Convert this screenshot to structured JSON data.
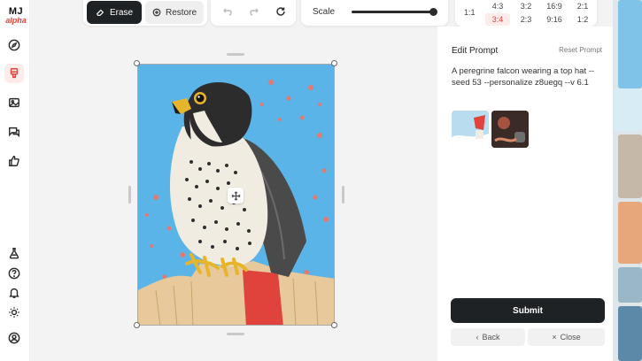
{
  "app": {
    "logo_main": "MJ",
    "logo_sub": "alpha"
  },
  "sidebar": {
    "items": [
      {
        "name": "explore",
        "icon": "compass-icon"
      },
      {
        "name": "create",
        "icon": "brush-icon",
        "active": true
      },
      {
        "name": "organize",
        "icon": "image-icon"
      },
      {
        "name": "chat",
        "icon": "chat-icon"
      },
      {
        "name": "rate",
        "icon": "thumbs-up-icon"
      }
    ],
    "bottom": [
      "flask-icon",
      "help-icon",
      "bell-icon",
      "sun-icon",
      "profile-icon"
    ]
  },
  "toolbar": {
    "erase_label": "Erase",
    "restore_label": "Restore",
    "scale_label": "Scale",
    "scale_value": 1.0
  },
  "aspect": {
    "main": "1:1",
    "options": [
      "4:3",
      "3:2",
      "16:9",
      "2:1",
      "3:4",
      "2:3",
      "9:16",
      "1:2"
    ],
    "selected": "3:4"
  },
  "panel": {
    "title": "Edit Prompt",
    "reset_label": "Reset Prompt",
    "prompt_text": "A peregrine falcon wearing a top hat --seed 53 --personalize z8uegq --v 6.1",
    "submit_label": "Submit",
    "back_label": "Back",
    "close_label": "Close"
  },
  "colors": {
    "accent": "#e0433b",
    "dark_button": "#1f2224",
    "canvas_bg": "#5bb4e8"
  }
}
